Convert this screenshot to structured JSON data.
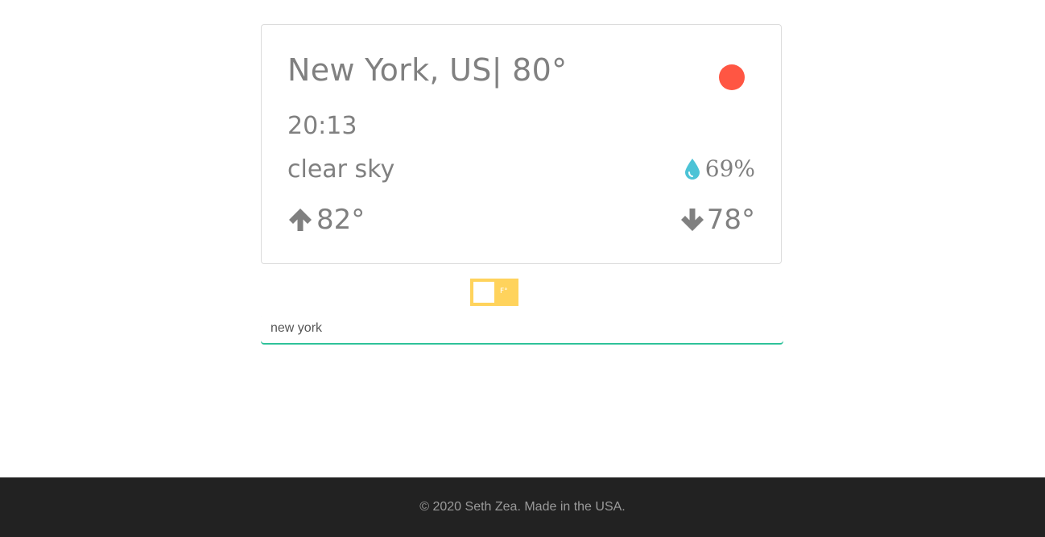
{
  "weather": {
    "location_title": "New York, US| 80°",
    "time": "20:13",
    "description": "clear sky",
    "humidity": "69%",
    "temp_max": "82°",
    "temp_min": "78°",
    "status_color": "#ff5643"
  },
  "icons": {
    "humidity": "water-drop-icon",
    "max": "arrow-up-icon",
    "min": "arrow-down-icon"
  },
  "unit_toggle": {
    "label": "F°",
    "color": "#ffd35c"
  },
  "search": {
    "value": "new york"
  },
  "footer": {
    "text": "© 2020 Seth Zea. Made in the USA."
  }
}
